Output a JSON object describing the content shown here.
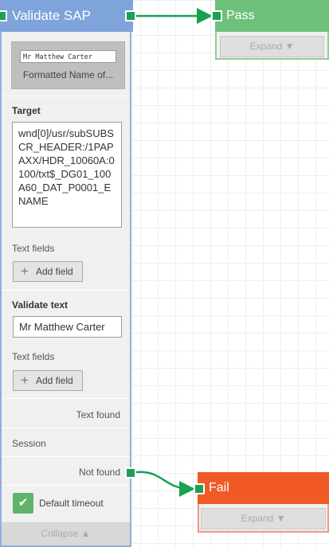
{
  "validate_node": {
    "title": "Validate SAP",
    "thumbnail": {
      "image_text": "Mr Matthew Carter",
      "caption": "Formatted Name of..."
    },
    "target_label": "Target",
    "target_value": "wnd[0]/usr/subSUBSCR_HEADER:/1PAPAXX/HDR_10060A:0100/txt$_DG01_100A60_DAT_P0001_ENAME",
    "text_fields_label_1": "Text fields",
    "add_field_1": "Add field",
    "validate_text_label": "Validate text",
    "validate_text_value": "Mr Matthew Carter",
    "text_fields_label_2": "Text fields",
    "add_field_2": "Add field",
    "text_found_label": "Text found",
    "session_label": "Session",
    "not_found_label": "Not found",
    "default_timeout_label": "Default timeout",
    "default_timeout_checked": true,
    "collapse_label": "Collapse ▲"
  },
  "pass_node": {
    "title": "Pass",
    "expand_label": "Expand ▼"
  },
  "fail_node": {
    "title": "Fail",
    "expand_label": "Expand ▼"
  },
  "colors": {
    "validate_header": "#7fa3db",
    "pass_header": "#6fc07b",
    "fail_header": "#f15a24",
    "connector": "#1aa152"
  },
  "icons": {
    "add": "plus-icon",
    "check": "checkmark-icon",
    "port": "port-square"
  }
}
